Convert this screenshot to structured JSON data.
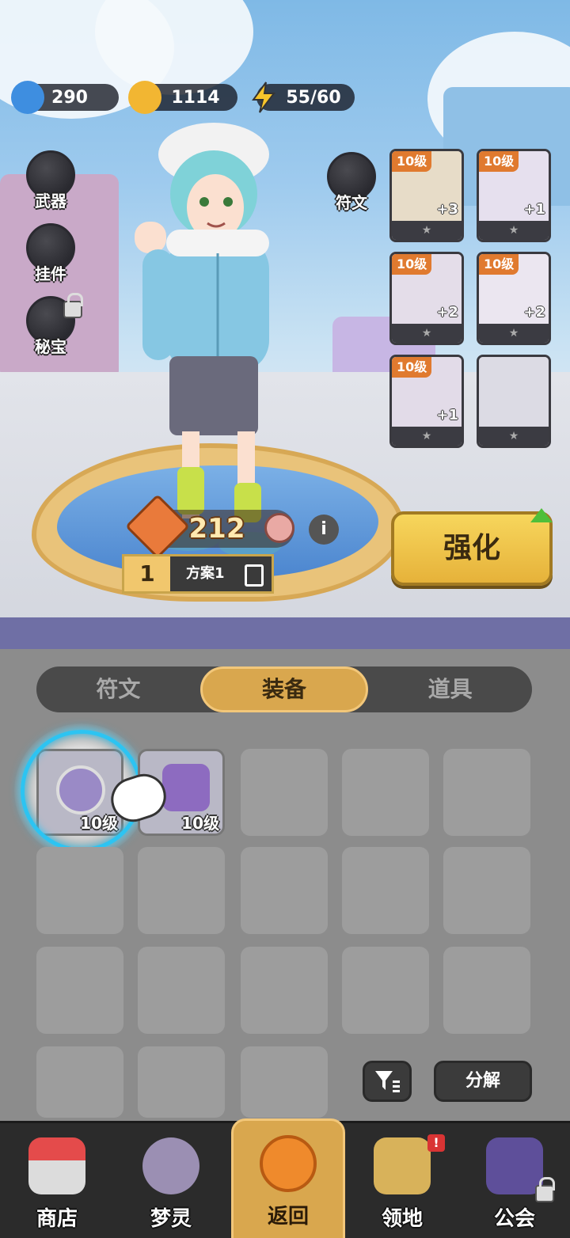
{
  "resources": {
    "gems": "290",
    "coins": "1114",
    "energy": "55/60"
  },
  "side_buttons": {
    "weapon": "武器",
    "pendant": "挂件",
    "secret": "秘宝"
  },
  "rune_button": "符文",
  "equipment_slots": [
    {
      "level": "10级",
      "plus": "+3"
    },
    {
      "level": "10级",
      "plus": "+1"
    },
    {
      "level": "10级",
      "plus": "+2"
    },
    {
      "level": "10级",
      "plus": "+2"
    },
    {
      "level": "10级",
      "plus": "+1"
    },
    {
      "level": "",
      "plus": ""
    }
  ],
  "power": {
    "value": "212",
    "plan_number": "1",
    "plan_name": "方案1"
  },
  "strengthen_label": "强化",
  "tabs": [
    "符文",
    "装备",
    "道具"
  ],
  "active_tab": "装备",
  "inventory": [
    {
      "level": "10级"
    },
    {
      "level": "10级"
    }
  ],
  "actions": {
    "filter_icon": "filter-icon",
    "decompose": "分解"
  },
  "nav": [
    "商店",
    "梦灵",
    "返回",
    "领地",
    "公会"
  ],
  "nav_badge": "!",
  "colors": {
    "accent_gold": "#d9a74e",
    "level_tag": "#e07a2f",
    "highlight_ring": "#2cc4f2"
  }
}
